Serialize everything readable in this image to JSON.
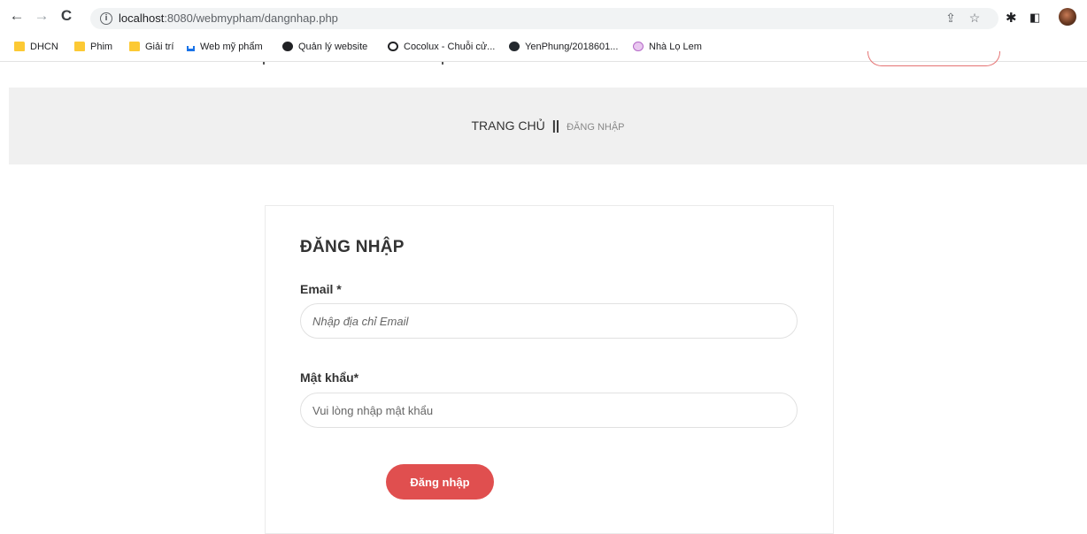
{
  "browser": {
    "url_host": "localhost",
    "url_path": ":8080/webmypham/dangnhap.php",
    "bookmarks": [
      {
        "label": "DHCN",
        "icon": "folder-icon"
      },
      {
        "label": "Phim",
        "icon": "folder-icon"
      },
      {
        "label": "Giải trí",
        "icon": "folder-icon"
      },
      {
        "label": "Web mỹ phẩm",
        "icon": "basket-icon"
      },
      {
        "label": "Quản lý website",
        "icon": "globe-icon"
      },
      {
        "label": "Cocolux - Chuỗi cử...",
        "icon": "cocolux-icon"
      },
      {
        "label": "YenPhung/2018601...",
        "icon": "github-icon"
      },
      {
        "label": "Nhà Lọ Lem",
        "icon": "nhalolem-icon"
      }
    ]
  },
  "breadcrumb": {
    "home": "TRANG CHỦ",
    "separator": "||",
    "current": "ĐĂNG NHẬP"
  },
  "login": {
    "title": "ĐĂNG NHẬP",
    "email_label": "Email *",
    "email_placeholder": "Nhập địa chỉ Email",
    "password_label": "Mật khẩu*",
    "password_placeholder": "Vui lòng nhập mật khẩu",
    "submit_label": "Đăng nhập"
  },
  "colors": {
    "accent": "#e04f4f",
    "band": "#f0f0f0"
  }
}
